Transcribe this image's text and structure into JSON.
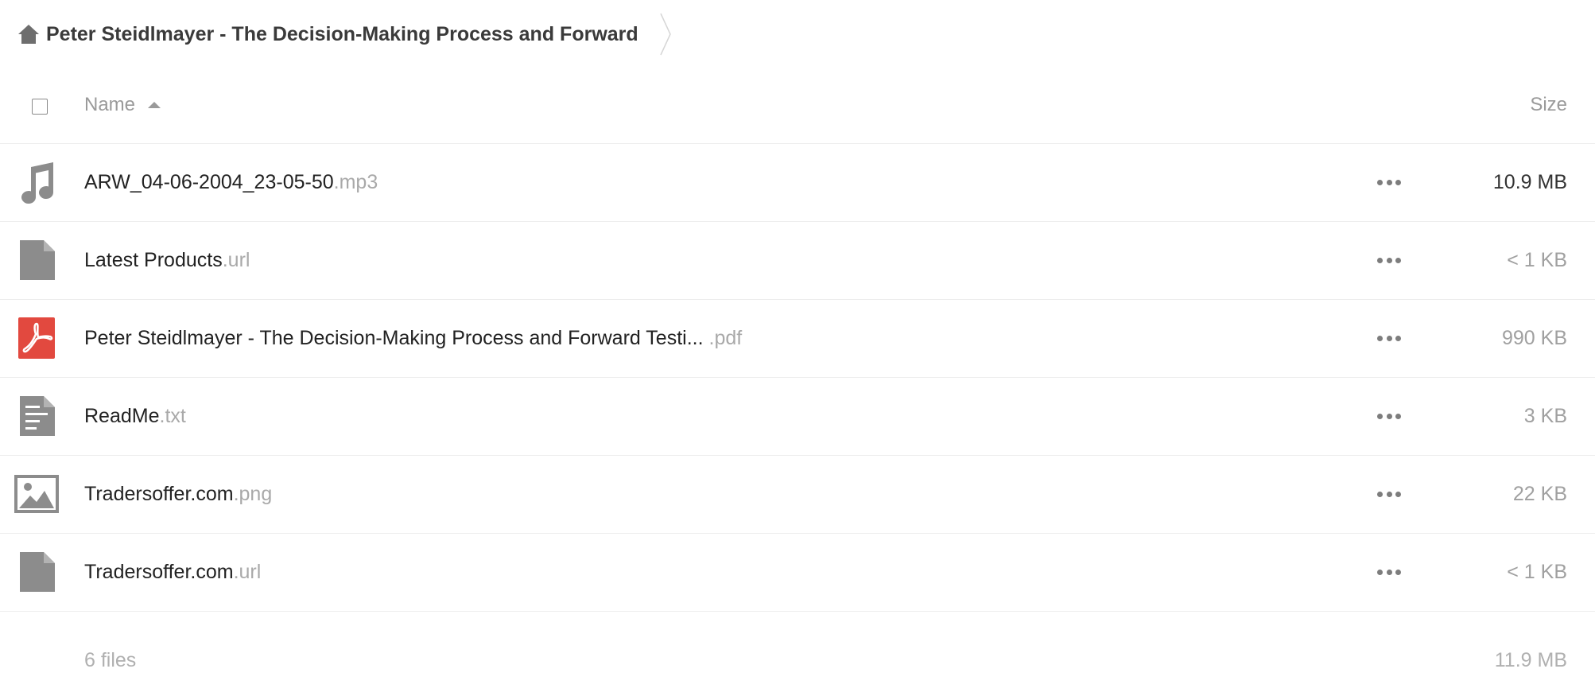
{
  "breadcrumb": {
    "home_icon": "home-icon",
    "title": "Peter Steidlmayer - The Decision-Making Process and Forward"
  },
  "header": {
    "name_label": "Name",
    "size_label": "Size",
    "sort": "ascending"
  },
  "files": [
    {
      "name": "ARW_04-06-2004_23-05-50",
      "ext": ".mp3",
      "size": "10.9 MB",
      "icon": "audio-file-icon"
    },
    {
      "name": "Latest Products",
      "ext": ".url",
      "size": "< 1 KB",
      "icon": "generic-file-icon"
    },
    {
      "name": "Peter Steidlmayer - The Decision-Making Process and Forward Testi...",
      "ext": " .pdf",
      "size": "990 KB",
      "icon": "pdf-file-icon"
    },
    {
      "name": "ReadMe",
      "ext": ".txt",
      "size": "3 KB",
      "icon": "text-file-icon"
    },
    {
      "name": "Tradersoffer.com",
      "ext": ".png",
      "size": "22 KB",
      "icon": "image-file-icon"
    },
    {
      "name": "Tradersoffer.com",
      "ext": ".url",
      "size": "< 1 KB",
      "icon": "generic-file-icon"
    }
  ],
  "footer": {
    "count": "6 files",
    "total_size": "11.9 MB"
  },
  "colors": {
    "icon_grey": "#8c8c8c",
    "pdf_red": "#e2493f"
  }
}
